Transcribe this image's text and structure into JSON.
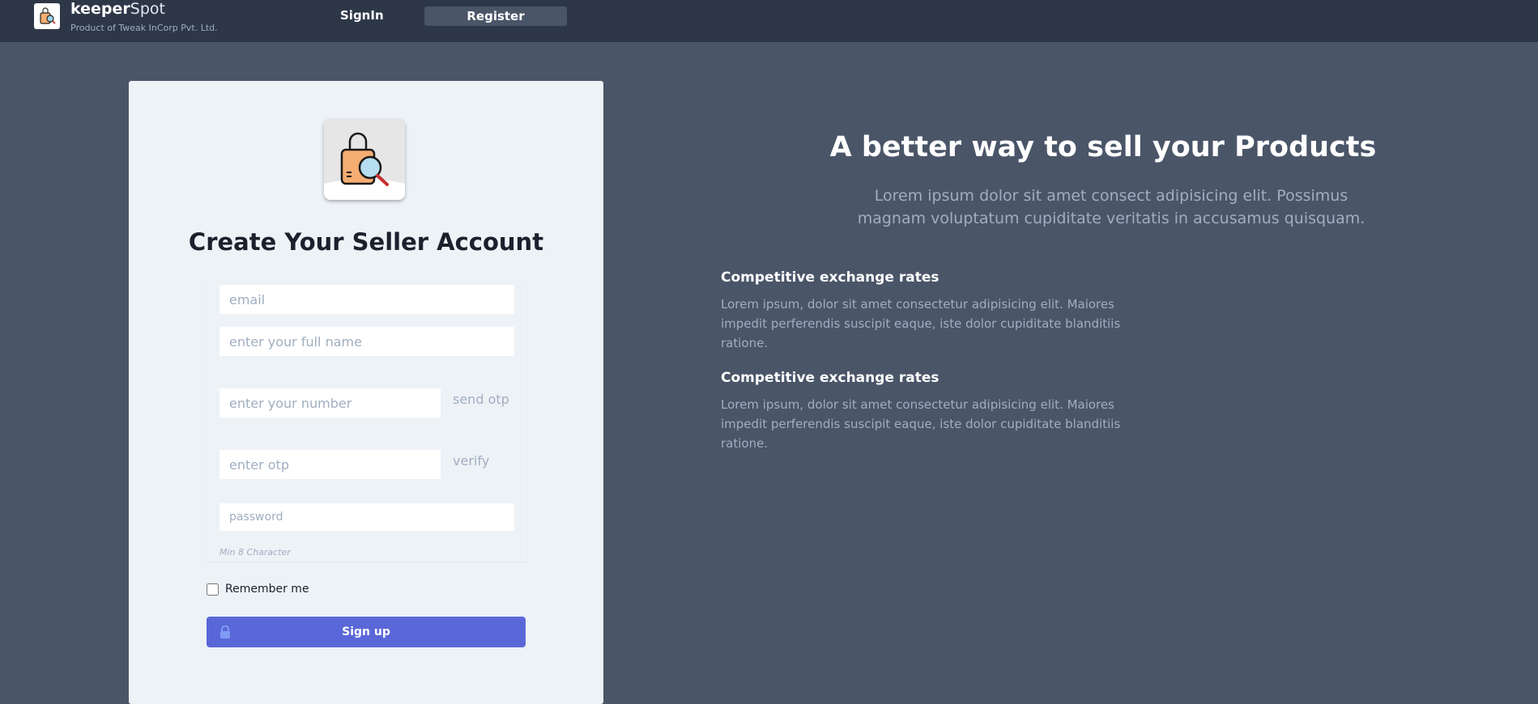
{
  "header": {
    "brand_bold": "keeper",
    "brand_light": "Spot",
    "tagline": "Product of Tweak InCorp Pvt. Ltd.",
    "signin_label": "SignIn",
    "register_label": "Register"
  },
  "form": {
    "title": "Create Your Seller Account",
    "email_placeholder": "email",
    "fullname_placeholder": "enter your full name",
    "number_placeholder": "enter your number",
    "send_otp_label": "send otp",
    "otp_placeholder": "enter otp",
    "verify_label": "verify",
    "password_placeholder": "password",
    "password_hint": "Min 8 Character",
    "remember_label": "Remember me",
    "signup_label": "Sign up"
  },
  "promo": {
    "headline": "A better way to sell your Products",
    "lede": "Lorem ipsum dolor sit amet consect adipisicing elit. Possimus magnam voluptatum cupiditate veritatis in accusamus quisquam.",
    "features": [
      {
        "title": "Competitive exchange rates",
        "text": "Lorem ipsum, dolor sit amet consectetur adipisicing elit. Maiores impedit perferendis suscipit eaque, iste dolor cupiditate blanditiis ratione."
      },
      {
        "title": "Competitive exchange rates",
        "text": "Lorem ipsum, dolor sit amet consectetur adipisicing elit. Maiores impedit perferendis suscipit eaque, iste dolor cupiditate blanditiis ratione."
      }
    ]
  },
  "colors": {
    "page_bg": "#4a5568",
    "topbar_bg": "#2d3748",
    "card_bg": "#edf2f7",
    "accent": "#5a67d8"
  },
  "icons": {
    "logo": "shopping-bag-magnifier-icon",
    "lock": "lock-icon"
  }
}
